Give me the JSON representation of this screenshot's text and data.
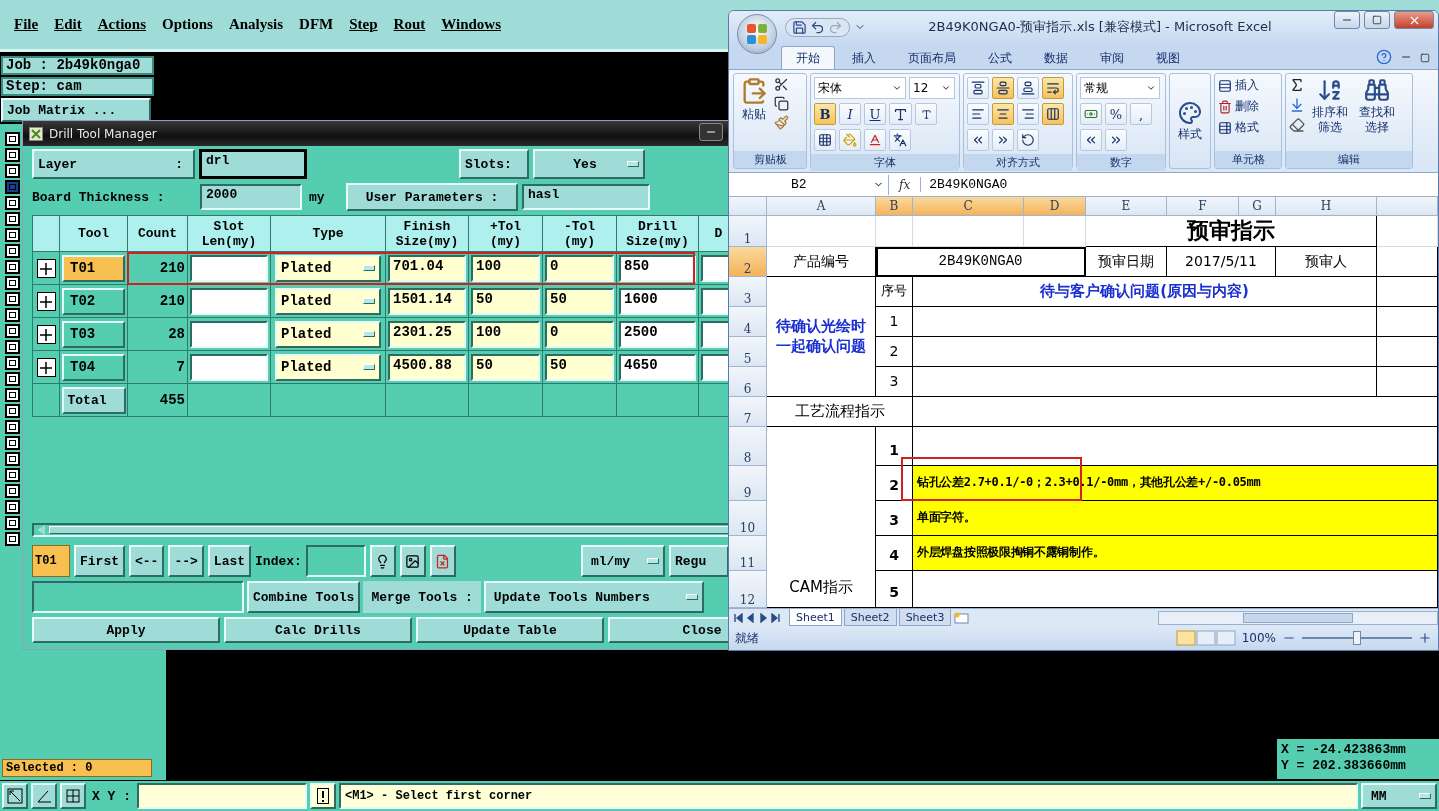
{
  "menu_bar": {
    "items": [
      {
        "label": "File",
        "mnemonic": true
      },
      {
        "label": "Edit",
        "mnemonic": true
      },
      {
        "label": "Actions",
        "mnemonic": true
      },
      {
        "label": "Options",
        "mnemonic": false
      },
      {
        "label": "Analysis",
        "mnemonic": false
      },
      {
        "label": "DFM",
        "mnemonic": false
      },
      {
        "label": "Step",
        "mnemonic": true
      },
      {
        "label": "Rout",
        "mnemonic": true
      },
      {
        "label": "Windows",
        "mnemonic": true
      }
    ]
  },
  "job_panel": {
    "job": "Job : 2b49k0nga0",
    "step": "Step: cam",
    "matrix_button": "Job Matrix ..."
  },
  "tool_icons": [
    {
      "selected": false
    },
    {
      "selected": false
    },
    {
      "selected": false
    },
    {
      "selected": true
    },
    {
      "selected": false
    },
    {
      "selected": false
    },
    {
      "selected": false
    },
    {
      "selected": false
    },
    {
      "selected": false
    },
    {
      "selected": false
    },
    {
      "selected": false
    },
    {
      "selected": false
    },
    {
      "selected": false
    },
    {
      "selected": false
    },
    {
      "selected": false
    },
    {
      "selected": false
    },
    {
      "selected": false
    },
    {
      "selected": false
    },
    {
      "selected": false
    },
    {
      "selected": false
    },
    {
      "selected": false
    },
    {
      "selected": false
    },
    {
      "selected": false
    },
    {
      "selected": false
    },
    {
      "selected": false
    },
    {
      "selected": false
    }
  ],
  "drill_tool_manager": {
    "title": "Drill Tool Manager",
    "layer_label": "Layer :",
    "layer": "drl",
    "slots_label": "Slots:",
    "slots": "Yes",
    "thickness_label": "Board Thickness :",
    "thickness": "2000",
    "thickness_unit": "my",
    "user_params_button": "User Parameters :",
    "user_params": "hasl",
    "columns": [
      "Tool",
      "Count",
      "Slot Len(my)",
      "Type",
      "Finish Size(my)",
      "+Tol (my)",
      "-Tol (my)",
      "Drill Size(my)",
      "D"
    ],
    "rows": [
      {
        "tool": "T01",
        "selected": true,
        "highlighted": true,
        "count": "210",
        "type": "Plated",
        "finish_size": "701.04",
        "plus_tol": "100",
        "minus_tol": "0",
        "drill_size": "850"
      },
      {
        "tool": "T02",
        "selected": false,
        "count": "210",
        "type": "Plated",
        "finish_size": "1501.14",
        "plus_tol": "50",
        "minus_tol": "50",
        "drill_size": "1600"
      },
      {
        "tool": "T03",
        "selected": false,
        "count": "28",
        "type": "Plated",
        "finish_size": "2301.25",
        "plus_tol": "100",
        "minus_tol": "0",
        "drill_size": "2500"
      },
      {
        "tool": "T04",
        "selected": false,
        "count": "7",
        "type": "Plated",
        "finish_size": "4500.88",
        "plus_tol": "50",
        "minus_tol": "50",
        "drill_size": "4650"
      }
    ],
    "total_label": "Total",
    "total": "455",
    "current_tool": "T01",
    "nav_buttons": [
      "First",
      "<--",
      "-->",
      "Last"
    ],
    "index_label": "Index:",
    "units": "ml/my",
    "regu_button": "Regu",
    "combine_button": "Combine Tools",
    "merge_label": "Merge Tools :",
    "merge_mode": "Update Tools Numbers",
    "action_buttons": [
      "Apply",
      "Calc Drills",
      "Update Table",
      "Close"
    ]
  },
  "selected_status": "Selected : 0",
  "coordinates": {
    "x": "X = -24.423863mm",
    "y": "Y = 202.383660mm"
  },
  "bottom_bar": {
    "xy_label": "X Y :",
    "message": "<M1> - Select first corner",
    "units": "MM"
  },
  "excel": {
    "title": "2B49K0NGA0-预审指示.xls  [兼容模式] - Microsoft Excel",
    "tabs": [
      {
        "label": "开始",
        "selected": true
      },
      {
        "label": "插入",
        "selected": false
      },
      {
        "label": "页面布局",
        "selected": false
      },
      {
        "label": "公式",
        "selected": false
      },
      {
        "label": "数据",
        "selected": false
      },
      {
        "label": "审阅",
        "selected": false
      },
      {
        "label": "视图",
        "selected": false
      }
    ],
    "clipboard": {
      "paste": "粘贴",
      "label": "剪贴板"
    },
    "font": {
      "name": "宋体",
      "size": "12",
      "label": "字体",
      "style_buttons": [
        {
          "label": "B",
          "active": true
        },
        {
          "label": "I",
          "active": false
        },
        {
          "label": "U",
          "active": false
        }
      ]
    },
    "alignment": {
      "label": "对齐方式",
      "buttons": [
        {
          "kind": "top",
          "active": false
        },
        {
          "kind": "middle",
          "active": true
        },
        {
          "kind": "bottom",
          "active": false
        },
        {
          "kind": "wrap",
          "active": true
        },
        {
          "kind": "left",
          "active": false
        },
        {
          "kind": "center",
          "active": true
        },
        {
          "kind": "right",
          "active": false
        },
        {
          "kind": "merge",
          "active": true
        }
      ]
    },
    "number": {
      "format": "常规",
      "percent": "%",
      "comma": ",",
      "label": "数字"
    },
    "styles": {
      "button": "样式"
    },
    "cells": {
      "insert": "插入",
      "delete": "删除",
      "format": "格式",
      "label": "单元格"
    },
    "editing": {
      "sort": "排序和筛选",
      "find": "查找和选择",
      "label": "编辑"
    },
    "name_box": "B2",
    "function_button": "fx",
    "formula": "2B49K0NGA0",
    "columns": [
      {
        "label": "A",
        "selected": false
      },
      {
        "label": "B",
        "selected": true
      },
      {
        "label": "C",
        "selected": true
      },
      {
        "label": "D",
        "selected": true
      },
      {
        "label": "E",
        "selected": false
      },
      {
        "label": "F",
        "selected": false
      },
      {
        "label": "G",
        "selected": false
      },
      {
        "label": "H",
        "selected": false
      }
    ],
    "row_headers": [
      {
        "label": "1",
        "selected": false
      },
      {
        "label": "2",
        "selected": true
      },
      {
        "label": "3",
        "selected": false
      },
      {
        "label": "4",
        "selected": false
      },
      {
        "label": "5",
        "selected": false
      },
      {
        "label": "6",
        "selected": false
      },
      {
        "label": "7",
        "selected": false
      },
      {
        "label": "8",
        "selected": false
      },
      {
        "label": "9",
        "selected": false
      },
      {
        "label": "10",
        "selected": false
      },
      {
        "label": "11",
        "selected": false
      },
      {
        "label": "12",
        "selected": false
      }
    ],
    "sheet": {
      "title": "预审指示",
      "product_label": "产品编号",
      "product_value": "2B49K0NGA0",
      "date_label": "预审日期",
      "date_value": "2017/5/11",
      "reviewer_label": "预审人",
      "confirm_label": "待确认光绘时一起确认问题",
      "index_header": "序号",
      "confirm_heading": "待与客户确认问题(原因与内容)",
      "confirm_items": [
        {
          "no": "1"
        },
        {
          "no": "2"
        },
        {
          "no": "3"
        }
      ],
      "process_label": "工艺流程指示",
      "cam_label": "CAM指示",
      "cam_items": [
        {
          "no": "1",
          "color": "#ffffff",
          "highlighted": false
        },
        {
          "no": "2",
          "text": "钻孔公差2.7+0.1/-0；2.3+0.1/-0mm，其他孔公差+/-0.05mm",
          "color": "#ffff00",
          "highlighted": true
        },
        {
          "no": "3",
          "text": "单面字符。",
          "color": "#ffff00",
          "highlighted": false
        },
        {
          "no": "4",
          "text": "外层焊盘按照极限掏铜不露铜制作。",
          "color": "#ffff00",
          "highlighted": false
        },
        {
          "no": "5",
          "color": "#ffffff",
          "highlighted": false
        }
      ]
    },
    "sheet_tabs": [
      {
        "label": "Sheet1",
        "selected": true
      },
      {
        "label": "Sheet2",
        "selected": false
      },
      {
        "label": "Sheet3",
        "selected": false
      }
    ],
    "status": "就绪",
    "zoom": "100%",
    "zoom_slider": {
      "level": 0.5
    }
  }
}
